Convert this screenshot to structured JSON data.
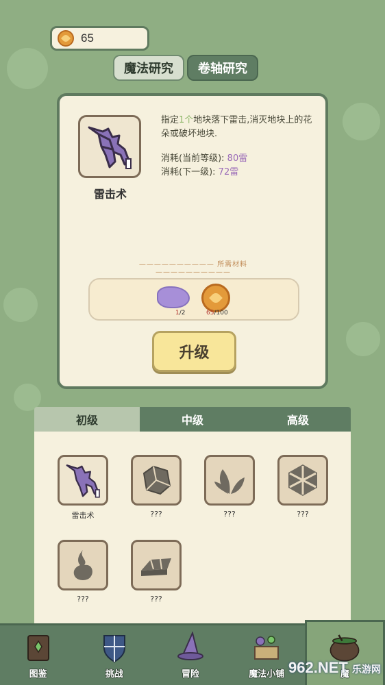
{
  "currency": {
    "amount": "65",
    "icon": "coin-icon"
  },
  "top_tabs": [
    {
      "label": "魔法研究",
      "active": true
    },
    {
      "label": "卷轴研究",
      "active": false
    }
  ],
  "selected_spell": {
    "name": "雷击术",
    "icon": "lightning-icon",
    "desc_before": "指定",
    "desc_highlight": "1个",
    "desc_after": "地块落下雷击,消灭地块上的花朵或破坏地块.",
    "cost_current_label": "消耗(当前等级):",
    "cost_current_value": "80雷",
    "cost_next_label": "消耗(下一级):",
    "cost_next_value": "72雷"
  },
  "materials": {
    "title": "—————————— 所需材料 ——————————",
    "items": [
      {
        "icon": "purple-crystal-icon",
        "have": "1",
        "need": "/2"
      },
      {
        "icon": "coin-icon",
        "have": "65",
        "need": "/100"
      }
    ]
  },
  "upgrade_label": "升级",
  "grade_tabs": [
    {
      "label": "初级",
      "active": true
    },
    {
      "label": "中级",
      "active": false
    },
    {
      "label": "高级",
      "active": false
    }
  ],
  "spells": [
    {
      "label": "雷击术",
      "icon": "lightning-icon"
    },
    {
      "label": "???",
      "icon": "rock-icon"
    },
    {
      "label": "???",
      "icon": "leaves-icon"
    },
    {
      "label": "???",
      "icon": "snowflake-icon"
    },
    {
      "label": "???",
      "icon": "flame-icon"
    },
    {
      "label": "???",
      "icon": "ingot-icon"
    }
  ],
  "bottom_nav": [
    {
      "label": "图鉴",
      "icon": "book-icon"
    },
    {
      "label": "挑战",
      "icon": "shield-icon"
    },
    {
      "label": "冒险",
      "icon": "wizard-hat-icon"
    },
    {
      "label": "魔法小铺",
      "icon": "shop-icon"
    },
    {
      "label": "魔",
      "icon": "cauldron-icon",
      "active": true
    }
  ],
  "watermark": {
    "main": "962.NET",
    "sub": "乐游网"
  }
}
